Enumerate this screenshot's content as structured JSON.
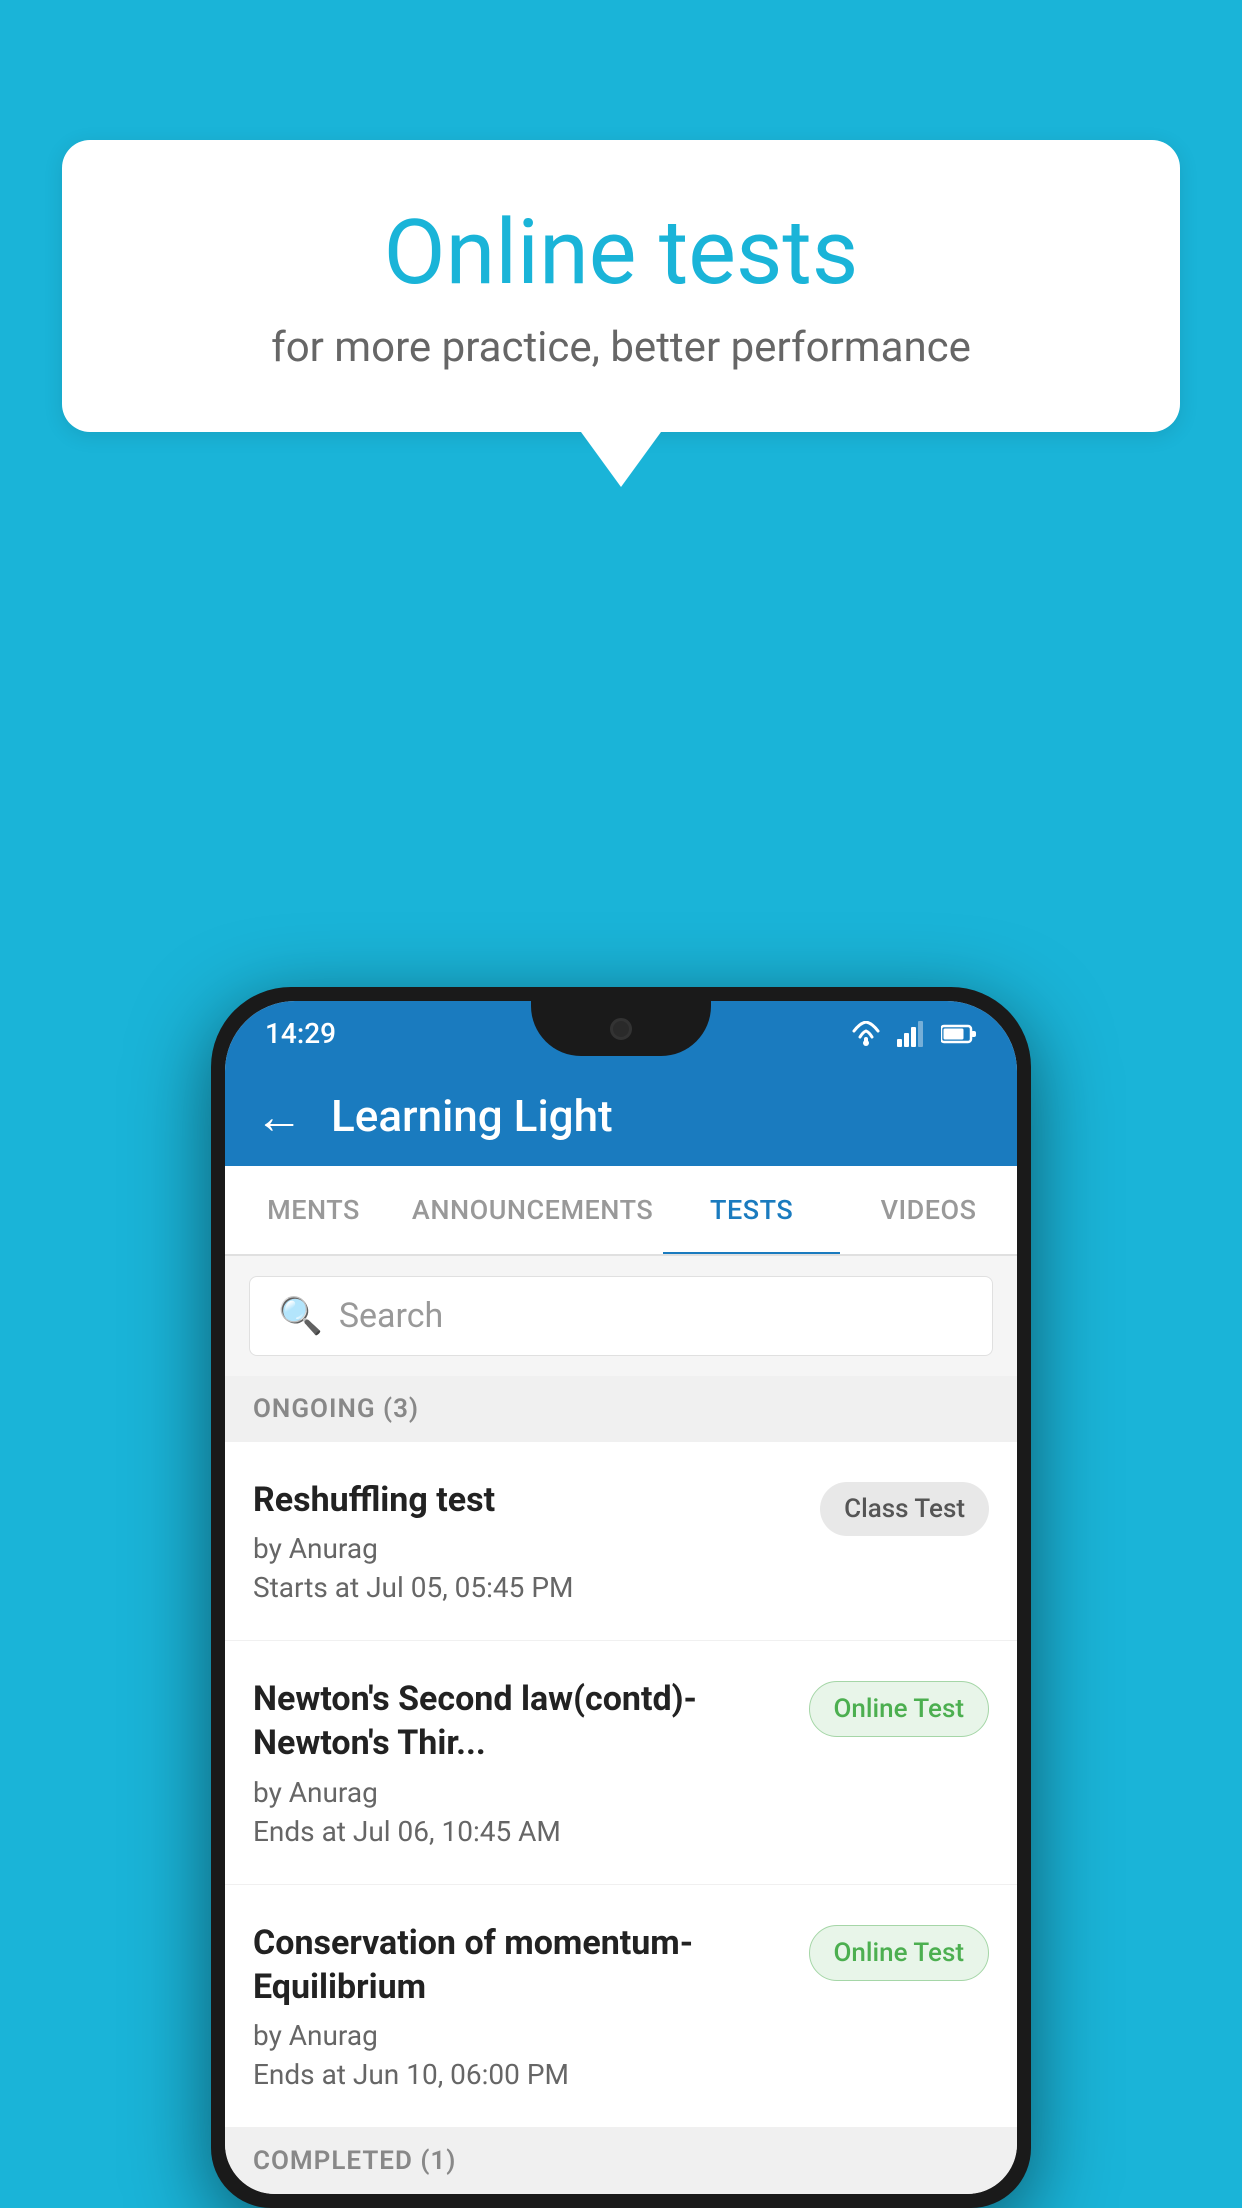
{
  "background_color": "#1ab4d8",
  "speech_bubble": {
    "title": "Online tests",
    "subtitle": "for more practice, better performance"
  },
  "phone": {
    "status_bar": {
      "time": "14:29",
      "wifi": "▼",
      "signal": "▲",
      "battery": "battery"
    },
    "header": {
      "title": "Learning Light",
      "back_label": "←"
    },
    "tabs": [
      {
        "label": "MENTS",
        "active": false
      },
      {
        "label": "ANNOUNCEMENTS",
        "active": false
      },
      {
        "label": "TESTS",
        "active": true
      },
      {
        "label": "VIDEOS",
        "active": false
      }
    ],
    "search": {
      "placeholder": "Search"
    },
    "ongoing_section": {
      "label": "ONGOING (3)"
    },
    "tests": [
      {
        "name": "Reshuffling test",
        "author": "by Anurag",
        "time_label": "Starts at",
        "time_value": "Jul 05, 05:45 PM",
        "badge": "Class Test",
        "badge_type": "class"
      },
      {
        "name": "Newton's Second law(contd)-Newton's Thir...",
        "author": "by Anurag",
        "time_label": "Ends at",
        "time_value": "Jul 06, 10:45 AM",
        "badge": "Online Test",
        "badge_type": "online"
      },
      {
        "name": "Conservation of momentum-Equilibrium",
        "author": "by Anurag",
        "time_label": "Ends at",
        "time_value": "Jun 10, 06:00 PM",
        "badge": "Online Test",
        "badge_type": "online"
      }
    ],
    "completed_section": {
      "label": "COMPLETED (1)"
    }
  }
}
